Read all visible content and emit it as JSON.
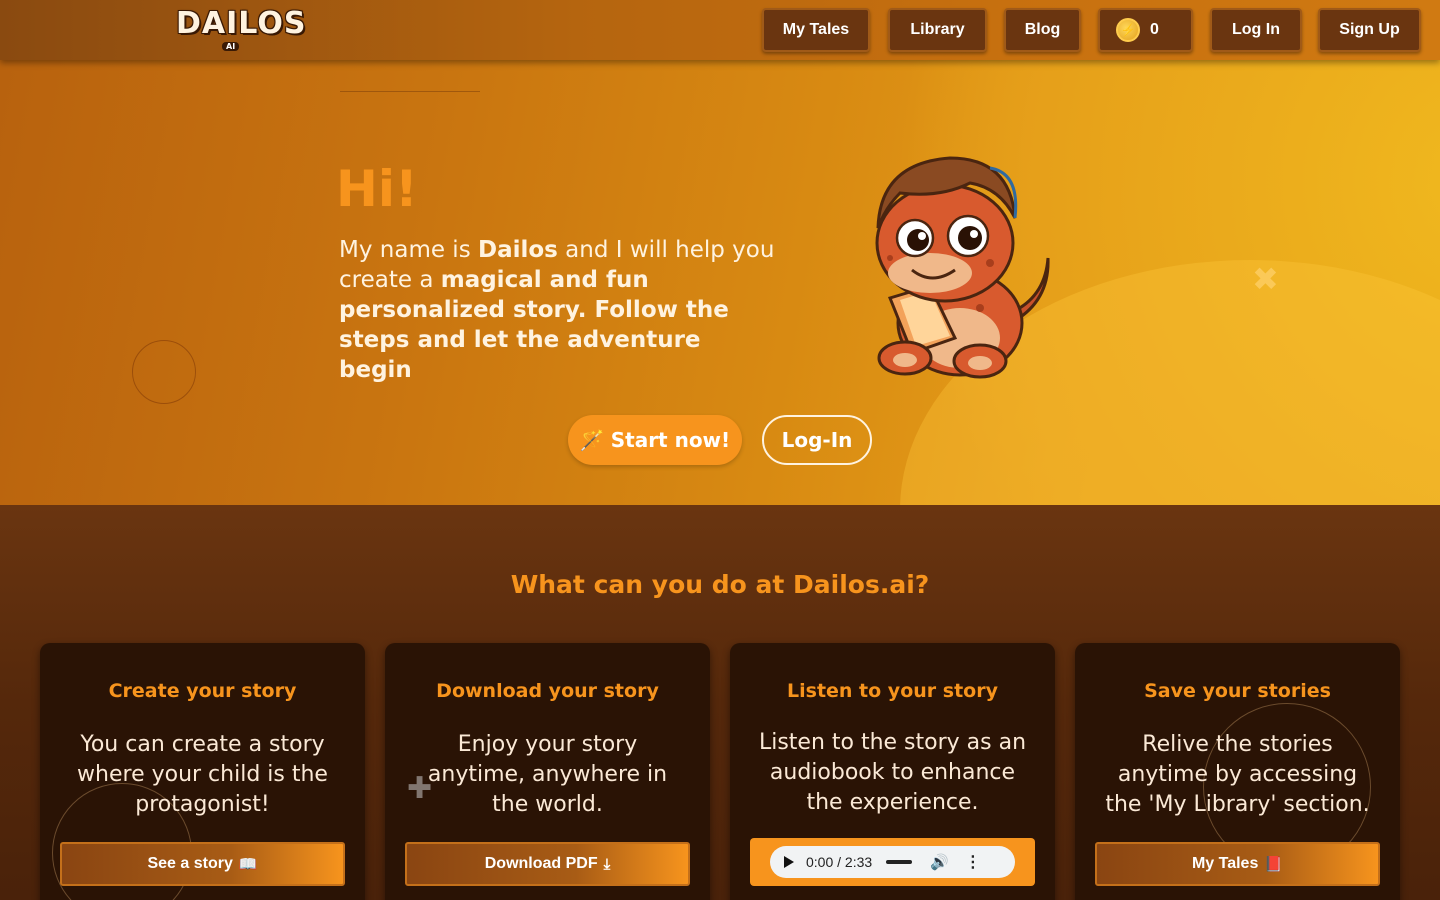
{
  "nav": {
    "logo_text": "DAILOS",
    "logo_sub": "AI",
    "items": [
      {
        "label": "My Tales"
      },
      {
        "label": "Library"
      },
      {
        "label": "Blog"
      }
    ],
    "coins": "0",
    "login_label": "Log In",
    "signup_label": "Sign Up"
  },
  "hero": {
    "title": "Hi!",
    "text_plain_1": "My name is ",
    "text_bold_1": "Dailos",
    "text_plain_2": " and I will help you create a ",
    "text_bold_2": "magical and fun personalized story. Follow the steps and let the adventure begin",
    "start_label": "Start now!",
    "login_label": "Log-In"
  },
  "features": {
    "title": "What can you do at Dailos.ai?",
    "cards": [
      {
        "title": "Create your story",
        "text": "You can create a story where your child is the protagonist!",
        "button": "See a story",
        "icon": "book-open-icon"
      },
      {
        "title": "Download your story",
        "text": "Enjoy your story anytime, anywhere in the world.",
        "button": "Download PDF",
        "icon": "download-icon"
      },
      {
        "title": "Listen to your story",
        "text": "Listen to the story as an audiobook to enhance the experience.",
        "audio_time": "0:00 / 2:33"
      },
      {
        "title": "Save your stories",
        "text": "Relive the stories anytime by accessing the 'My Library' section.",
        "button": "My Tales",
        "icon": "book-icon"
      }
    ]
  },
  "colors": {
    "accent": "#f7941d",
    "nav_button_bg": "#6a3510",
    "card_bg": "#2a1305",
    "hero_bg_left": "#b8620e",
    "hero_bg_right": "#efb220"
  }
}
